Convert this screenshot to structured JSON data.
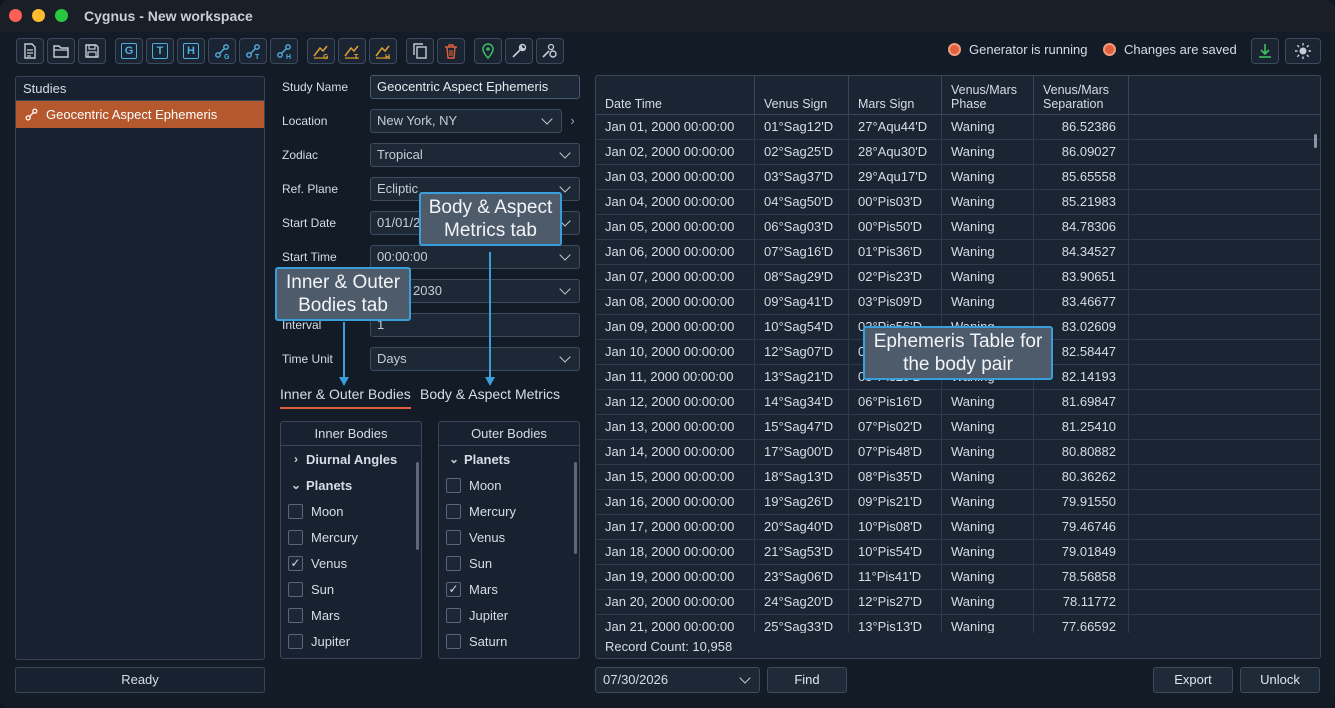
{
  "window": {
    "title": "Cygnus - New workspace"
  },
  "toolbar": {
    "buttons": [
      {
        "name": "new-document-icon",
        "kind": "svg"
      },
      {
        "name": "open-folder-icon",
        "kind": "svg"
      },
      {
        "name": "save-icon",
        "kind": "svg"
      },
      {
        "name": "geocentric-icon",
        "kind": "letter",
        "letter": "G"
      },
      {
        "name": "topocentric-icon",
        "kind": "letter",
        "letter": "T"
      },
      {
        "name": "heliocentric-icon",
        "kind": "letter",
        "letter": "H"
      }
    ],
    "status_generator": "Generator is running",
    "status_saved": "Changes are saved"
  },
  "studies": {
    "header": "Studies",
    "items": [
      {
        "label": "Geocentric Aspect Ephemeris"
      }
    ]
  },
  "status_bar": {
    "text": "Ready"
  },
  "form": {
    "study_name_label": "Study Name",
    "study_name_value": "Geocentric Aspect Ephemeris",
    "location_label": "Location",
    "location_value": "New York, NY",
    "zodiac_label": "Zodiac",
    "zodiac_value": "Tropical",
    "ref_plane_label": "Ref. Plane",
    "ref_plane_value": "Ecliptic",
    "start_date_label": "Start Date",
    "start_date_value": "01/01/2",
    "start_time_label": "Start Time",
    "start_time_value": "00:00:00",
    "end_value": "2030",
    "interval_label": "Interval",
    "interval_value": "1",
    "time_unit_label": "Time Unit",
    "time_unit_value": "Days"
  },
  "tabs": [
    {
      "label": "Inner & Outer Bodies",
      "active": true
    },
    {
      "label": "Body & Aspect Metrics",
      "active": false
    }
  ],
  "inner_bodies": {
    "header": "Inner Bodies",
    "rows": [
      {
        "type": "group",
        "label": "Diurnal Angles",
        "expanded": false
      },
      {
        "type": "group",
        "label": "Planets",
        "expanded": true
      },
      {
        "type": "item",
        "label": "Moon",
        "checked": false
      },
      {
        "type": "item",
        "label": "Mercury",
        "checked": false
      },
      {
        "type": "item",
        "label": "Venus",
        "checked": true
      },
      {
        "type": "item",
        "label": "Sun",
        "checked": false
      },
      {
        "type": "item",
        "label": "Mars",
        "checked": false
      },
      {
        "type": "item",
        "label": "Jupiter",
        "checked": false
      }
    ]
  },
  "outer_bodies": {
    "header": "Outer Bodies",
    "rows": [
      {
        "type": "group",
        "label": "Planets",
        "expanded": true
      },
      {
        "type": "item",
        "label": "Moon",
        "checked": false
      },
      {
        "type": "item",
        "label": "Mercury",
        "checked": false
      },
      {
        "type": "item",
        "label": "Venus",
        "checked": false
      },
      {
        "type": "item",
        "label": "Sun",
        "checked": false
      },
      {
        "type": "item",
        "label": "Mars",
        "checked": true
      },
      {
        "type": "item",
        "label": "Jupiter",
        "checked": false
      },
      {
        "type": "item",
        "label": "Saturn",
        "checked": false
      }
    ]
  },
  "ephemeris": {
    "columns": [
      "Date Time",
      "Venus Sign",
      "Mars Sign",
      "Venus/Mars Phase",
      "Venus/Mars Separation"
    ],
    "rows": [
      [
        "Jan 01, 2000 00:00:00",
        "01°Sag12'D",
        "27°Aqu44'D",
        "Waning",
        "86.52386"
      ],
      [
        "Jan 02, 2000 00:00:00",
        "02°Sag25'D",
        "28°Aqu30'D",
        "Waning",
        "86.09027"
      ],
      [
        "Jan 03, 2000 00:00:00",
        "03°Sag37'D",
        "29°Aqu17'D",
        "Waning",
        "85.65558"
      ],
      [
        "Jan 04, 2000 00:00:00",
        "04°Sag50'D",
        "00°Pis03'D",
        "Waning",
        "85.21983"
      ],
      [
        "Jan 05, 2000 00:00:00",
        "06°Sag03'D",
        "00°Pis50'D",
        "Waning",
        "84.78306"
      ],
      [
        "Jan 06, 2000 00:00:00",
        "07°Sag16'D",
        "01°Pis36'D",
        "Waning",
        "84.34527"
      ],
      [
        "Jan 07, 2000 00:00:00",
        "08°Sag29'D",
        "02°Pis23'D",
        "Waning",
        "83.90651"
      ],
      [
        "Jan 08, 2000 00:00:00",
        "09°Sag41'D",
        "03°Pis09'D",
        "Waning",
        "83.46677"
      ],
      [
        "Jan 09, 2000 00:00:00",
        "10°Sag54'D",
        "03°Pis56'D",
        "Waning",
        "83.02609"
      ],
      [
        "Jan 10, 2000 00:00:00",
        "12°Sag07'D",
        "04°Pis42'D",
        "Waning",
        "82.58447"
      ],
      [
        "Jan 11, 2000 00:00:00",
        "13°Sag21'D",
        "05°Pis29'D",
        "Waning",
        "82.14193"
      ],
      [
        "Jan 12, 2000 00:00:00",
        "14°Sag34'D",
        "06°Pis16'D",
        "Waning",
        "81.69847"
      ],
      [
        "Jan 13, 2000 00:00:00",
        "15°Sag47'D",
        "07°Pis02'D",
        "Waning",
        "81.25410"
      ],
      [
        "Jan 14, 2000 00:00:00",
        "17°Sag00'D",
        "07°Pis48'D",
        "Waning",
        "80.80882"
      ],
      [
        "Jan 15, 2000 00:00:00",
        "18°Sag13'D",
        "08°Pis35'D",
        "Waning",
        "80.36262"
      ],
      [
        "Jan 16, 2000 00:00:00",
        "19°Sag26'D",
        "09°Pis21'D",
        "Waning",
        "79.91550"
      ],
      [
        "Jan 17, 2000 00:00:00",
        "20°Sag40'D",
        "10°Pis08'D",
        "Waning",
        "79.46746"
      ],
      [
        "Jan 18, 2000 00:00:00",
        "21°Sag53'D",
        "10°Pis54'D",
        "Waning",
        "79.01849"
      ],
      [
        "Jan 19, 2000 00:00:00",
        "23°Sag06'D",
        "11°Pis41'D",
        "Waning",
        "78.56858"
      ],
      [
        "Jan 20, 2000 00:00:00",
        "24°Sag20'D",
        "12°Pis27'D",
        "Waning",
        "78.11772"
      ],
      [
        "Jan 21, 2000 00:00:00",
        "25°Sag33'D",
        "13°Pis13'D",
        "Waning",
        "77.66592"
      ]
    ],
    "record_count": "Record Count:  10,958"
  },
  "bottom": {
    "date_value": "07/30/2026",
    "find_label": "Find",
    "export_label": "Export",
    "unlock_label": "Unlock"
  },
  "callouts": {
    "body_aspect": "Body & Aspect Metrics tab",
    "inner_outer": "Inner & Outer Bodies tab",
    "ephemeris": "Ephemeris Table for the body pair"
  },
  "colors": {
    "accent": "#e0603c",
    "selection": "#b5582e",
    "callout_border": "#3a9edb",
    "icon_blue": "#4fb0e0",
    "icon_orange": "#e0a030",
    "icon_green": "#3cc060"
  }
}
